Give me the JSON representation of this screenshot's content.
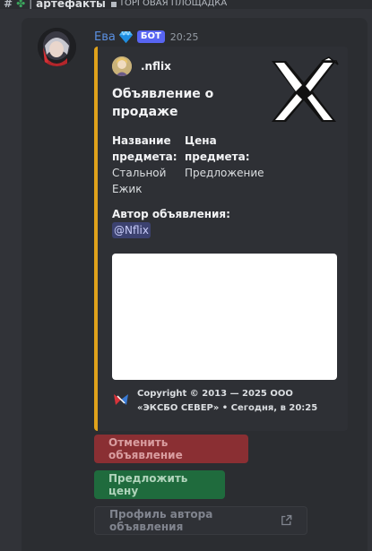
{
  "topbar": {
    "hash": "#",
    "clover": "✤",
    "separator": "|",
    "channel": "артефакты",
    "category": "ТОРГОВАЯ ПЛОЩАДКА"
  },
  "message": {
    "author": "Ева",
    "bot_tag": "БОТ",
    "time": "20:25"
  },
  "embed": {
    "accent_color": "#e0a21b",
    "author_name": ".nflix",
    "title": "Объявление о продаже",
    "fields": [
      {
        "name": "Название предмета:",
        "value": "Стальной Ежик"
      },
      {
        "name": "Цена предмета:",
        "value": "Предложение"
      },
      {
        "name": "Автор объявления:",
        "value": "@Nflix"
      }
    ],
    "footer": "Copyright © 2013 — 2025 ООО «ЭКСБО СЕВЕР» • Сегодня, в 20:25"
  },
  "buttons": {
    "cancel": "Отменить объявление",
    "offer": "Предложить цену",
    "profile": "Профиль автора объявления"
  },
  "colors": {
    "cancel_bg": "#8a2f33",
    "offer_bg": "#1f6b3d",
    "mention_bg": "#3c4270"
  }
}
